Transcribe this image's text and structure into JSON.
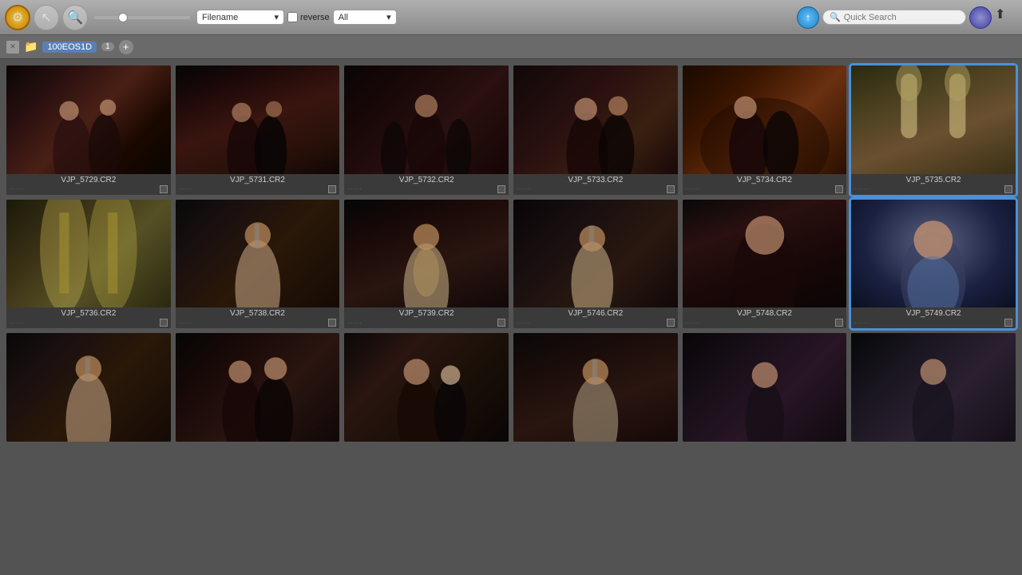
{
  "toolbar": {
    "sort_label": "Filename",
    "reverse_label": "reverse",
    "filter_label": "All",
    "quick_search_placeholder": "Quick Search",
    "upload_icon": "↑",
    "gear_icon": "⚙",
    "cursor_icon": "↖",
    "search_magnify": "🔍",
    "share_icon": "⬆"
  },
  "second_bar": {
    "folder_name": "100EOS1D",
    "folder_count": "1",
    "close_icon": "✕",
    "add_icon": "+"
  },
  "photos": [
    {
      "id": "row1_1",
      "filename": "VJP_5729.CR2",
      "css_class": "photo-wedding-dance",
      "selected": false
    },
    {
      "id": "row1_2",
      "filename": "VJP_5731.CR2",
      "css_class": "photo-couple-dance",
      "selected": false
    },
    {
      "id": "row1_3",
      "filename": "VJP_5732.CR2",
      "css_class": "photo-ballroom",
      "selected": false
    },
    {
      "id": "row1_4",
      "filename": "VJP_5733.CR2",
      "css_class": "photo-elegant",
      "selected": false
    },
    {
      "id": "row1_5",
      "filename": "VJP_5734.CR2",
      "css_class": "photo-warm-dark",
      "selected": false
    },
    {
      "id": "row1_6",
      "filename": "VJP_5735.CR2",
      "css_class": "photo-champagne",
      "selected": true
    },
    {
      "id": "row2_1",
      "filename": "VJP_5736.CR2",
      "css_class": "photo-champagne2",
      "selected": false,
      "corner": true
    },
    {
      "id": "row2_2",
      "filename": "VJP_5738.CR2",
      "css_class": "photo-speech",
      "selected": false,
      "corner": true
    },
    {
      "id": "row2_3",
      "filename": "VJP_5739.CR2",
      "css_class": "photo-speech2",
      "selected": false,
      "corner": true
    },
    {
      "id": "row2_4",
      "filename": "VJP_5746.CR2",
      "css_class": "photo-speech3",
      "selected": false
    },
    {
      "id": "row2_5",
      "filename": "VJP_5748.CR2",
      "css_class": "photo-portrait",
      "selected": false,
      "corner": true
    },
    {
      "id": "row2_6",
      "filename": "VJP_5749.CR2",
      "css_class": "photo-portrait2",
      "selected": true
    },
    {
      "id": "row3_1",
      "filename": "",
      "css_class": "photo-speech",
      "selected": false,
      "corner": true
    },
    {
      "id": "row3_2",
      "filename": "",
      "css_class": "photo-toast",
      "selected": false
    },
    {
      "id": "row3_3",
      "filename": "",
      "css_class": "photo-toast2",
      "selected": false
    },
    {
      "id": "row3_4",
      "filename": "",
      "css_class": "photo-toast3",
      "selected": false
    },
    {
      "id": "row3_5",
      "filename": "",
      "css_class": "photo-dancing2",
      "selected": false
    },
    {
      "id": "row3_6",
      "filename": "",
      "css_class": "photo-toast4",
      "selected": false
    }
  ],
  "stars": [
    "★",
    "★",
    "★",
    "★",
    "★"
  ],
  "colors": {
    "accent": "#4a90d9",
    "toolbar_bg": "#909090",
    "grid_bg": "#535353"
  }
}
